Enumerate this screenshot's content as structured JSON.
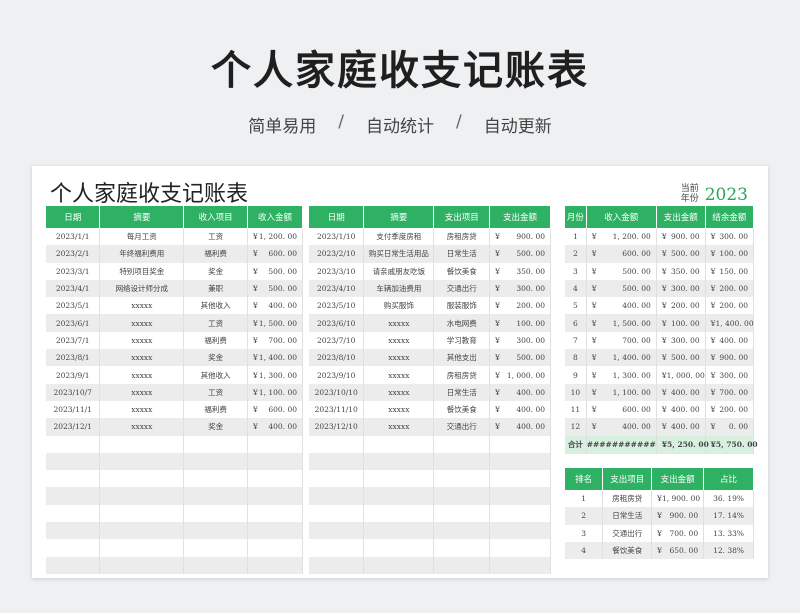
{
  "hero": {
    "title": "个人家庭收支记账表",
    "tags": [
      "简单易用",
      "自动统计",
      "自动更新"
    ],
    "sep": "/"
  },
  "sheet": {
    "title": "个人家庭收支记账表",
    "year_label_1": "当前",
    "year_label_2": "年份",
    "year": "2023"
  },
  "income": {
    "headers": [
      "日期",
      "摘要",
      "收入项目",
      "收入金额"
    ],
    "rows": [
      [
        "2023/1/1",
        "每月工资",
        "工资",
        "1, 200. 00"
      ],
      [
        "2023/2/1",
        "年终福利费用",
        "福利费",
        "600. 00"
      ],
      [
        "2023/3/1",
        "特别项目奖金",
        "奖金",
        "500. 00"
      ],
      [
        "2023/4/1",
        "网络设计师分成",
        "兼职",
        "500. 00"
      ],
      [
        "2023/5/1",
        "xxxxx",
        "其他收入",
        "400. 00"
      ],
      [
        "2023/6/1",
        "xxxxx",
        "工资",
        "1, 500. 00"
      ],
      [
        "2023/7/1",
        "xxxxx",
        "福利费",
        "700. 00"
      ],
      [
        "2023/8/1",
        "xxxxx",
        "奖金",
        "1, 400. 00"
      ],
      [
        "2023/9/1",
        "xxxxx",
        "其他收入",
        "1, 300. 00"
      ],
      [
        "2023/10/7",
        "xxxxx",
        "工资",
        "1, 100. 00"
      ],
      [
        "2023/11/1",
        "xxxxx",
        "福利费",
        "600. 00"
      ],
      [
        "2023/12/1",
        "xxxxx",
        "奖金",
        "400. 00"
      ]
    ],
    "empty_rows": 8
  },
  "expense": {
    "headers": [
      "日期",
      "摘要",
      "支出项目",
      "支出金额"
    ],
    "rows": [
      [
        "2023/1/10",
        "支付季度房租",
        "房租房贷",
        "900. 00"
      ],
      [
        "2023/2/10",
        "购买日常生活用品",
        "日常生活",
        "500. 00"
      ],
      [
        "2023/3/10",
        "请亲戚朋友吃饭",
        "餐饮美食",
        "350. 00"
      ],
      [
        "2023/4/10",
        "车辆加油费用",
        "交通出行",
        "300. 00"
      ],
      [
        "2023/5/10",
        "购买服饰",
        "服装服饰",
        "200. 00"
      ],
      [
        "2023/6/10",
        "xxxxx",
        "水电网费",
        "100. 00"
      ],
      [
        "2023/7/10",
        "xxxxx",
        "学习教育",
        "300. 00"
      ],
      [
        "2023/8/10",
        "xxxxx",
        "其他支出",
        "500. 00"
      ],
      [
        "2023/9/10",
        "xxxxx",
        "房租房贷",
        "1, 000. 00"
      ],
      [
        "2023/10/10",
        "xxxxx",
        "日常生活",
        "400. 00"
      ],
      [
        "2023/11/10",
        "xxxxx",
        "餐饮美食",
        "400. 00"
      ],
      [
        "2023/12/10",
        "xxxxx",
        "交通出行",
        "400. 00"
      ]
    ],
    "empty_rows": 8
  },
  "monthly": {
    "headers": [
      "月份",
      "收入金额",
      "支出金额",
      "结余金额"
    ],
    "rows": [
      [
        "1",
        "1, 200. 00",
        "900. 00",
        "300. 00"
      ],
      [
        "2",
        "600. 00",
        "500. 00",
        "100. 00"
      ],
      [
        "3",
        "500. 00",
        "350. 00",
        "150. 00"
      ],
      [
        "4",
        "500. 00",
        "300. 00",
        "200. 00"
      ],
      [
        "5",
        "400. 00",
        "200. 00",
        "200. 00"
      ],
      [
        "6",
        "1, 500. 00",
        "100. 00",
        "1, 400. 00"
      ],
      [
        "7",
        "700. 00",
        "300. 00",
        "400. 00"
      ],
      [
        "8",
        "1, 400. 00",
        "500. 00",
        "900. 00"
      ],
      [
        "9",
        "1, 300. 00",
        "1, 000. 00",
        "300. 00"
      ],
      [
        "10",
        "1, 100. 00",
        "400. 00",
        "700. 00"
      ],
      [
        "11",
        "600. 00",
        "400. 00",
        "200. 00"
      ],
      [
        "12",
        "400. 00",
        "400. 00",
        "0. 00"
      ]
    ],
    "total": [
      "合计",
      "###########",
      "5, 250. 00",
      "5, 750. 00"
    ]
  },
  "ranking": {
    "headers": [
      "排名",
      "支出项目",
      "支出金额",
      "占比"
    ],
    "rows": [
      [
        "1",
        "房租房贷",
        "1, 900. 00",
        "36. 19%"
      ],
      [
        "2",
        "日常生活",
        "900. 00",
        "17. 14%"
      ],
      [
        "3",
        "交通出行",
        "700. 00",
        "13. 33%"
      ],
      [
        "4",
        "餐饮美食",
        "650. 00",
        "12. 38%"
      ]
    ]
  },
  "currency": "¥",
  "colors": {
    "accent": "#2fb164",
    "total_bg": "#d7f0df",
    "stripe": "#ececec"
  }
}
